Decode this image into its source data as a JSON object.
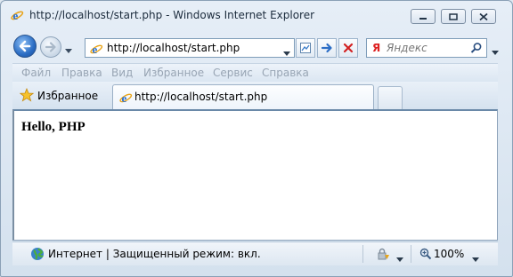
{
  "window": {
    "title": "http://localhost/start.php - Windows Internet Explorer"
  },
  "address_bar": {
    "url": "http://localhost/start.php"
  },
  "search": {
    "placeholder": "Яндекс",
    "brand_icon": "yandex-icon"
  },
  "menu": {
    "items": [
      "Файл",
      "Правка",
      "Вид",
      "Избранное",
      "Сервис",
      "Справка"
    ]
  },
  "tabs": {
    "favorites_label": "Избранное",
    "active_tab_label": "http://localhost/start.php"
  },
  "page": {
    "heading": "Hello, PHP"
  },
  "status": {
    "zone_text": "Интернет | Защищенный режим: вкл.",
    "zoom": "100%"
  },
  "colors": {
    "accent": "#2b6dc4",
    "stop": "#d22222",
    "disabled_menu": "#98a5b4"
  }
}
